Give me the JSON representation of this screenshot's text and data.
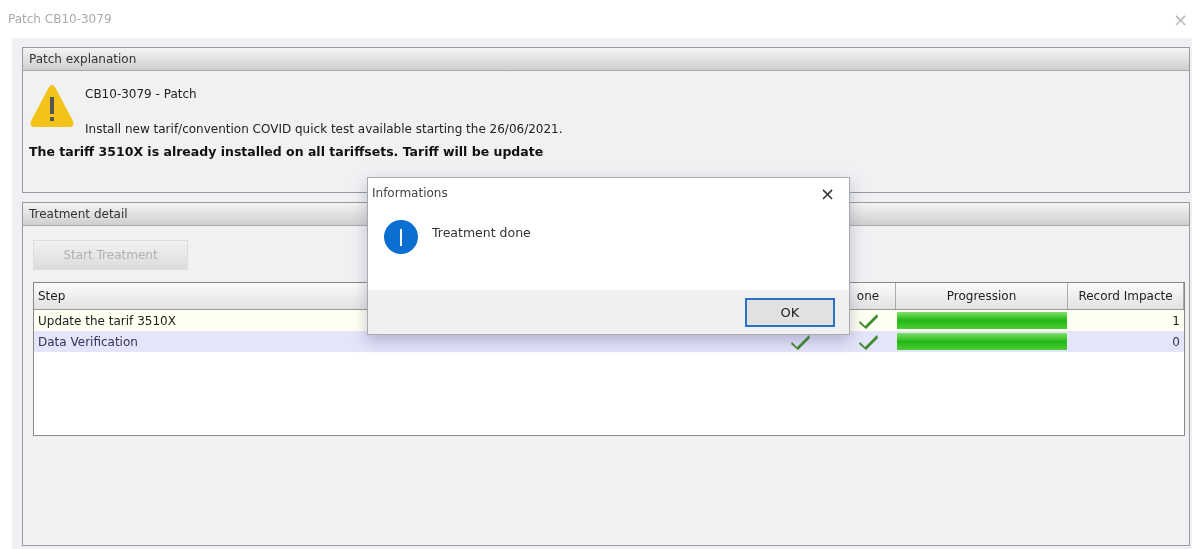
{
  "window": {
    "title": "Patch CB10-3079",
    "close": "×"
  },
  "patch_explanation": {
    "title": "Patch explanation",
    "heading": "CB10-3079 - Patch",
    "description": "Install new tarif/convention COVID quick test available starting the 26/06/2021.",
    "notice": "The tariff 3510X is already installed on all tariffsets. Tariff will be update"
  },
  "treatment_detail": {
    "title": "Treatment detail",
    "start_button": {
      "label": "Start Treatment",
      "disabled": true
    },
    "table": {
      "columns": [
        "Step",
        "",
        "one",
        "Progression",
        "Record Impacte"
      ],
      "rows": [
        {
          "step": "Update the tarif 3510X",
          "done": true,
          "level": 1,
          "records": "1",
          "selected": false
        },
        {
          "step": "Data Verification",
          "column_2": true,
          "done": true,
          "level": 1,
          "records": "0",
          "selected": true
        }
      ]
    }
  },
  "dialog": {
    "title": "Informations",
    "close": "×",
    "message": "Treatment done",
    "button": "OK"
  }
}
